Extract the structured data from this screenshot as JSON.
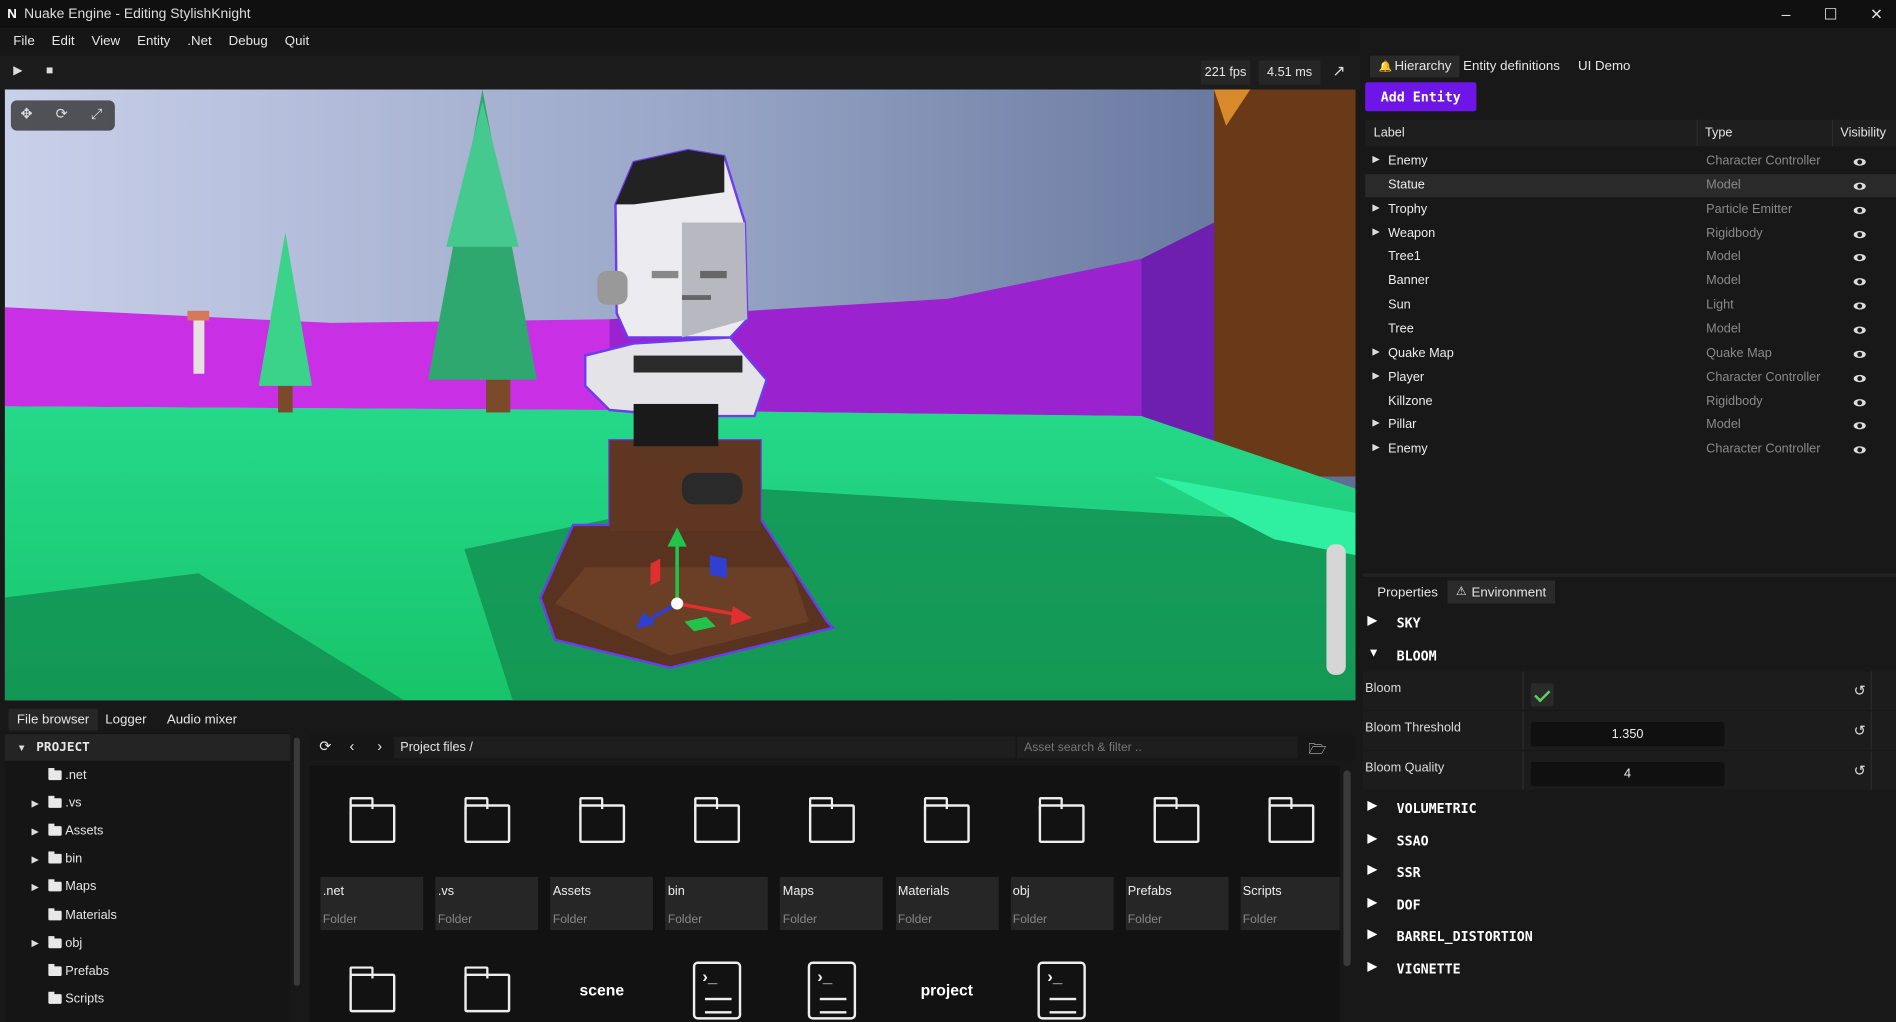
{
  "window": {
    "title": "Nuake Engine - Editing StylishKnight",
    "logo": "N",
    "controls": [
      "–",
      "☐",
      "✕"
    ]
  },
  "menu": [
    "File",
    "Edit",
    "View",
    "Entity",
    ".Net",
    "Debug",
    "Quit"
  ],
  "viewport": {
    "fps": "221 fps",
    "frame_time": "4.51 ms"
  },
  "bottom_tabs": [
    "File browser",
    "Logger",
    "Audio mixer"
  ],
  "tree": {
    "root": "PROJECT",
    "items": [
      {
        "label": ".net",
        "expandable": false
      },
      {
        "label": ".vs",
        "expandable": true
      },
      {
        "label": "Assets",
        "expandable": true
      },
      {
        "label": "bin",
        "expandable": true
      },
      {
        "label": "Maps",
        "expandable": true
      },
      {
        "label": "Materials",
        "expandable": false
      },
      {
        "label": "obj",
        "expandable": true
      },
      {
        "label": "Prefabs",
        "expandable": false
      },
      {
        "label": "Scripts",
        "expandable": false
      }
    ]
  },
  "file_browser": {
    "path": "Project files",
    "path_sep": "/",
    "search_placeholder": "Asset search & filter ..",
    "folder_type": "Folder",
    "folders": [
      ".net",
      ".vs",
      "Assets",
      "bin",
      "Maps",
      "Materials",
      "obj",
      "Prefabs",
      "Scripts"
    ],
    "second_row": [
      "folder",
      "folder",
      "scene",
      "script",
      "script",
      "project",
      "script"
    ],
    "scene_label": "scene",
    "project_label": "project"
  },
  "right_tabs": [
    "Hierarchy",
    "Entity definitions",
    "UI Demo"
  ],
  "add_entity_label": "Add Entity",
  "hierarchy": {
    "columns": [
      "Label",
      "Type",
      "Visibility"
    ],
    "rows": [
      {
        "label": "Enemy",
        "type": "Character Controller",
        "expandable": true
      },
      {
        "label": "Statue",
        "type": "Model",
        "expandable": false
      },
      {
        "label": "Trophy",
        "type": "Particle Emitter",
        "expandable": true
      },
      {
        "label": "Weapon",
        "type": "Rigidbody",
        "expandable": true
      },
      {
        "label": "Tree1",
        "type": "Model",
        "expandable": false
      },
      {
        "label": "Banner",
        "type": "Model",
        "expandable": false
      },
      {
        "label": "Sun",
        "type": "Light",
        "expandable": false
      },
      {
        "label": "Tree",
        "type": "Model",
        "expandable": false
      },
      {
        "label": "Quake Map",
        "type": "Quake Map",
        "expandable": true
      },
      {
        "label": "Player",
        "type": "Character Controller",
        "expandable": true
      },
      {
        "label": "Killzone",
        "type": "Rigidbody",
        "expandable": false
      },
      {
        "label": "Pillar",
        "type": "Model",
        "expandable": true
      },
      {
        "label": "Enemy",
        "type": "Character Controller",
        "expandable": true
      }
    ],
    "selected": "Statue"
  },
  "prop_tabs": [
    "Properties",
    "Environment"
  ],
  "environment": {
    "sections_top": [
      "SKY",
      "BLOOM"
    ],
    "bloom_props": [
      {
        "label": "Bloom",
        "value": "checked"
      },
      {
        "label": "Bloom Threshold",
        "value": "1.350"
      },
      {
        "label": "Bloom Quality",
        "value": "4"
      }
    ],
    "sections_bottom": [
      "VOLUMETRIC",
      "SSAO",
      "SSR",
      "DOF",
      "BARREL_DISTORTION",
      "VIGNETTE"
    ]
  },
  "colors": {
    "accent": "#6e16e8",
    "floor": "#1ee27a",
    "walls": "#b61fe0"
  }
}
